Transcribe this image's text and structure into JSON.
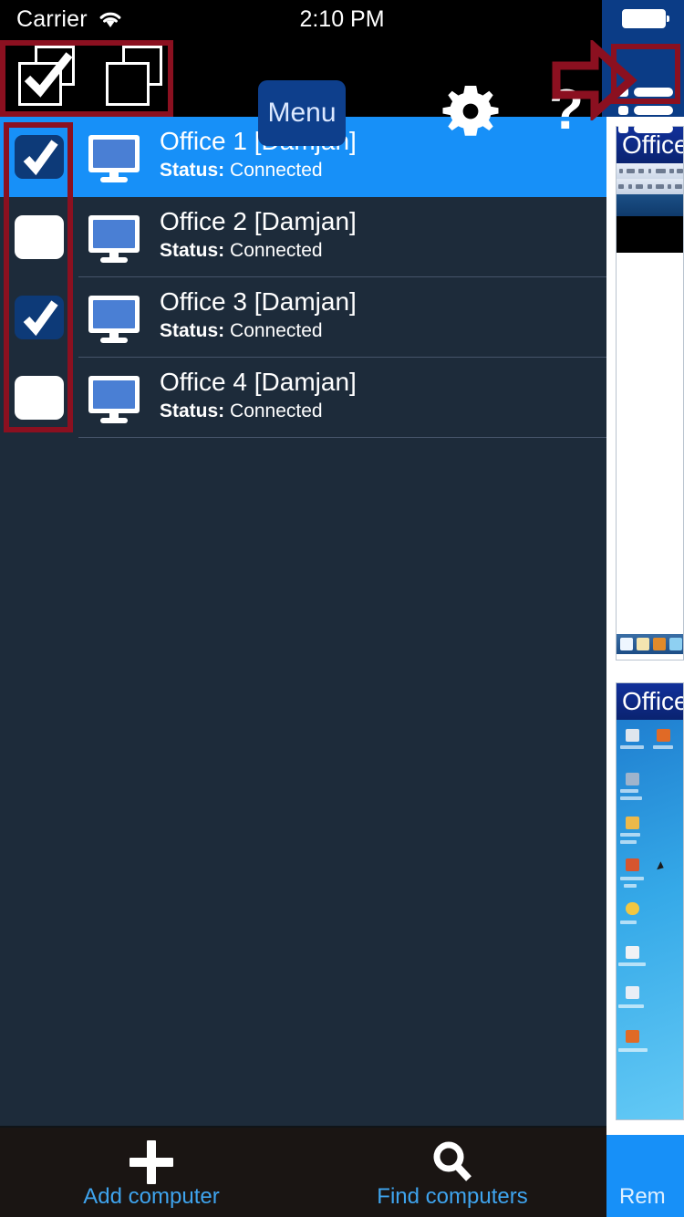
{
  "status_bar": {
    "carrier": "Carrier",
    "wifi_icon": "wifi-icon",
    "time": "2:10 PM",
    "battery_icon": "battery-full-icon"
  },
  "toolbar": {
    "select_all_icon": "select-all-checkbox-stack-icon",
    "deselect_all_icon": "deselect-all-stack-icon",
    "menu_label": "Menu",
    "settings_icon": "gear-icon",
    "help_label": "?",
    "list_view_icon": "list-view-icon"
  },
  "annotations": {
    "color": "#8b1020",
    "arrow_target": "list-view-icon",
    "boxes": [
      "toolbar-select-icons",
      "list-view-icon",
      "row-checkboxes"
    ]
  },
  "computer_list": {
    "rows": [
      {
        "checked": true,
        "selected": true,
        "name": "Office 1 [Damjan]",
        "status_label": "Status:",
        "status_value": "Connected"
      },
      {
        "checked": false,
        "selected": false,
        "name": "Office 2 [Damjan]",
        "status_label": "Status:",
        "status_value": "Connected"
      },
      {
        "checked": true,
        "selected": false,
        "name": "Office 3 [Damjan]",
        "status_label": "Status:",
        "status_value": "Connected"
      },
      {
        "checked": false,
        "selected": false,
        "name": "Office 4 [Damjan]",
        "status_label": "Status:",
        "status_value": "Connected"
      }
    ],
    "computer_icon": "desktop-monitor-icon"
  },
  "thumbnails": {
    "items": [
      {
        "title": "Office",
        "kind": "windows-application-window"
      },
      {
        "title": "Office",
        "kind": "windows-xp-desktop"
      }
    ]
  },
  "bottom_bar": {
    "tabs": [
      {
        "label": "Add computer",
        "icon": "plus-icon"
      },
      {
        "label": "Find computers",
        "icon": "search-icon"
      }
    ],
    "remote_label": "Rem"
  },
  "colors": {
    "accent_blue": "#1790f8",
    "navy": "#0e3f8c",
    "row_bg": "#1d2b3a",
    "tabbar_bg": "#1a1513",
    "annotation_red": "#8b1020",
    "link_blue": "#3fa4ee"
  }
}
